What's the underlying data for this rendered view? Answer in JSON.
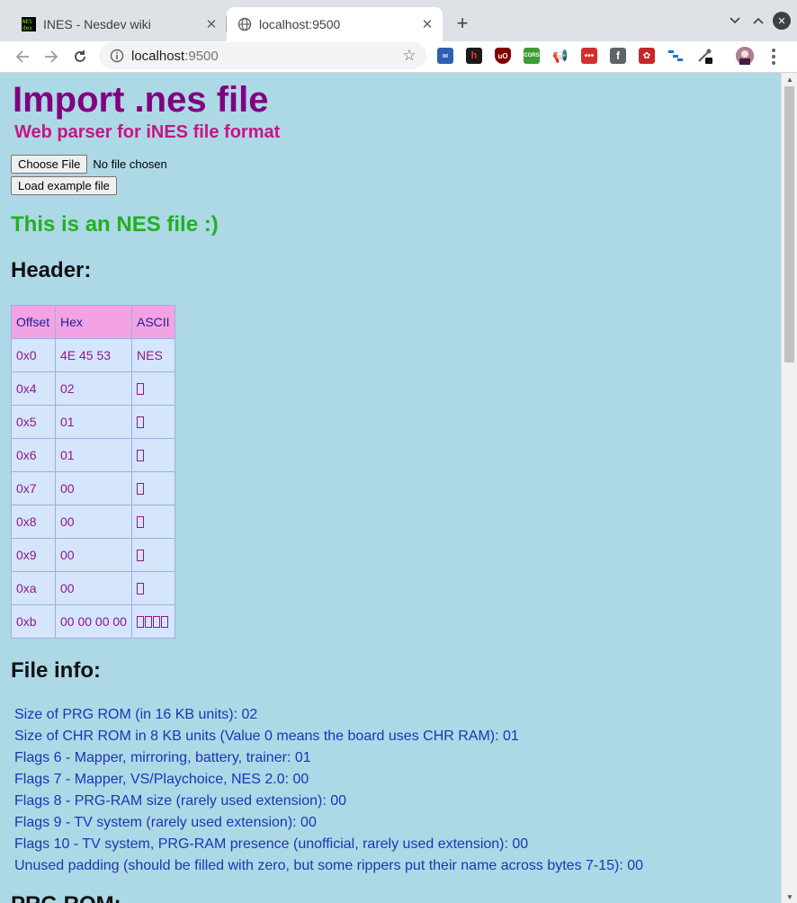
{
  "browser": {
    "tabs": [
      {
        "title": "INES - Nesdev wiki",
        "active": false
      },
      {
        "title": "localhost:9500",
        "active": true
      }
    ],
    "url_host": "localhost",
    "url_port": ":9500",
    "new_tab_symbol": "+",
    "extensions": [
      "mail-icon",
      "h-icon",
      "ublock-icon",
      "cors-icon",
      "megaphone-icon",
      "dots-icon",
      "facebook-icon",
      "reddit-icon",
      "flow-icon",
      "eyedropper-icon",
      "profile-avatar"
    ]
  },
  "page": {
    "title": "Import .nes file",
    "subtitle": "Web parser for iNES file format",
    "choose_file_label": "Choose File",
    "no_file_text": "No file chosen",
    "load_example_label": "Load example file",
    "status_message": "This is an NES file :)",
    "header_heading": "Header:",
    "file_info_heading": "File info:",
    "next_heading": "PRG ROM:"
  },
  "header_table": {
    "columns": [
      "Offset",
      "Hex",
      "ASCII"
    ],
    "rows": [
      {
        "offset": "0x0",
        "hex": "4E 45 53",
        "ascii": "NES",
        "glyphs": 0
      },
      {
        "offset": "0x4",
        "hex": "02",
        "ascii": "",
        "glyphs": 1
      },
      {
        "offset": "0x5",
        "hex": "01",
        "ascii": "",
        "glyphs": 1
      },
      {
        "offset": "0x6",
        "hex": "01",
        "ascii": "",
        "glyphs": 1
      },
      {
        "offset": "0x7",
        "hex": "00",
        "ascii": "",
        "glyphs": 1
      },
      {
        "offset": "0x8",
        "hex": "00",
        "ascii": "",
        "glyphs": 1
      },
      {
        "offset": "0x9",
        "hex": "00",
        "ascii": "",
        "glyphs": 1
      },
      {
        "offset": "0xa",
        "hex": "00",
        "ascii": "",
        "glyphs": 1
      },
      {
        "offset": "0xb",
        "hex": "00 00 00 00",
        "ascii": "",
        "glyphs": 4
      }
    ]
  },
  "file_info": [
    "Size of PRG ROM (in 16 KB units): 02",
    "Size of CHR ROM in 8 KB units (Value 0 means the board uses CHR RAM): 01",
    "Flags 6 - Mapper, mirroring, battery, trainer: 01",
    "Flags 7 - Mapper, VS/Playchoice, NES 2.0: 00",
    "Flags 8 - PRG-RAM size (rarely used extension): 00",
    "Flags 9 - TV system (rarely used extension): 00",
    "Flags 10 - TV system, PRG-RAM presence (unofficial, rarely used extension): 00",
    "Unused padding (should be filled with zero, but some rippers put their name across bytes 7-15): 00"
  ],
  "colors": {
    "page_background": "#add8e6",
    "title": "#800080",
    "subtitle": "#c71585",
    "status": "#22b022",
    "table_header": "#f3a3e3",
    "table_cell": "#d5e5fb",
    "info_text": "#1c36b4"
  }
}
